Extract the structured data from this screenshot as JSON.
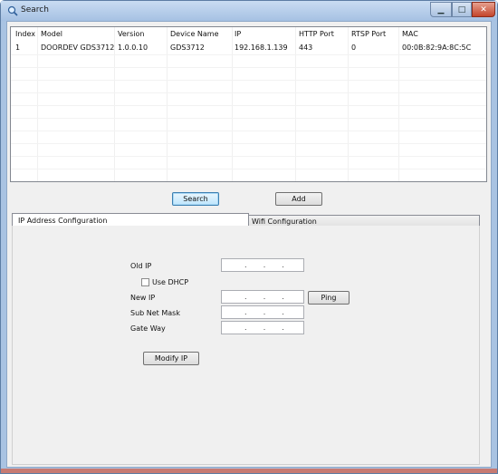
{
  "window": {
    "title": "Search",
    "minimize": "▁",
    "maximize": "□",
    "close": "✕"
  },
  "list": {
    "columns": [
      "Index",
      "Model",
      "Version",
      "Device Name",
      "IP",
      "HTTP Port",
      "RTSP Port",
      "MAC"
    ],
    "rows": [
      [
        "1",
        "DOORDEV GDS3712",
        "1.0.0.10",
        "GDS3712",
        "192.168.1.139",
        "443",
        "0",
        "00:0B:82:9A:8C:5C"
      ]
    ]
  },
  "buttons": {
    "search": "Search",
    "add": "Add",
    "ping": "Ping",
    "modify_ip": "Modify IP"
  },
  "tabs": {
    "ip_config": "IP Address Configuration",
    "wifi_config": "Wifi Configuration",
    "active": "ip_config"
  },
  "form": {
    "old_ip_label": "Old IP",
    "use_dhcp_label": "Use DHCP",
    "use_dhcp_checked": false,
    "new_ip_label": "New IP",
    "subnet_mask_label": "Sub Net Mask",
    "gateway_label": "Gate Way",
    "ip_separator": "."
  }
}
